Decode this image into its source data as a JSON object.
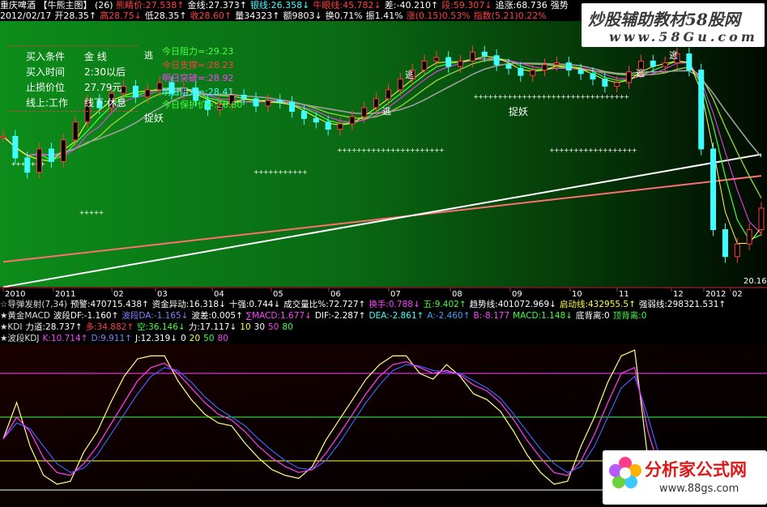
{
  "app": {
    "stock_name": "重庆啤酒",
    "tab_label": "【牛熊主图】",
    "tab_count": "(26)",
    "watermark_top": "炒股辅助教材58股网",
    "watermark_top_url": "www.58Gu.com",
    "watermark_bottom": "分析家公式网",
    "watermark_bottom_url": "www.88gs.com"
  },
  "header_row1": [
    {
      "text": "熊睛价:27.538↑",
      "color": "#ff4040"
    },
    {
      "text": "金线:27.373↑",
      "color": "#ffffff"
    },
    {
      "text": "银线:26.358↓",
      "color": "#40ffff"
    },
    {
      "text": "牛眼线:45.782↓",
      "color": "#ff4040"
    },
    {
      "text": "差:-40.210↑",
      "color": "#ffffff"
    },
    {
      "text": "段:59.307↓",
      "color": "#ff4040"
    },
    {
      "text": "追涨:68.736",
      "color": "#ffffff"
    },
    {
      "text": "强势",
      "color": "#ffffff"
    }
  ],
  "header_row2": [
    {
      "text": "2012/02/17",
      "color": "#ffffff"
    },
    {
      "text": "开28.35↑",
      "color": "#ffffff"
    },
    {
      "text": "高28.75↓",
      "color": "#ff4040"
    },
    {
      "text": "低28.35↑",
      "color": "#ffffff"
    },
    {
      "text": "收28.60↑",
      "color": "#ff4040"
    },
    {
      "text": "量34323↑",
      "color": "#ffffff"
    },
    {
      "text": "额9803↓",
      "color": "#ffffff"
    },
    {
      "text": "换0.71%",
      "color": "#ffffff"
    },
    {
      "text": "振1.41%",
      "color": "#ffffff"
    },
    {
      "text": "涨(0.15)0.53%",
      "color": "#ff4040"
    },
    {
      "text": "指数(5.21)0.22%",
      "color": "#ff4040"
    }
  ],
  "info_box": [
    {
      "label": "买入条件",
      "value": "金 线"
    },
    {
      "label": "买入时间",
      "value": "2:30以后"
    },
    {
      "label": "止损价位",
      "value": "27.79元"
    },
    {
      "label": "线上:工作",
      "value": "线下:休息"
    }
  ],
  "levels": [
    {
      "text": "今日阻力=:29.23",
      "color": "#40ff40"
    },
    {
      "text": "今日支撑=:28.23",
      "color": "#ff4040"
    },
    {
      "text": "明日突破=:28.92",
      "color": "#ff40ff"
    },
    {
      "text": "明日阻力=:28.41",
      "color": "#40ffff"
    },
    {
      "text": "今日保护价=:28.80",
      "color": "#40ff40"
    }
  ],
  "chart_labels": {
    "escape": "逃",
    "catch": "捉妖",
    "last_low": "20.16"
  },
  "x_axis": {
    "ticks": [
      "2010",
      "2011",
      "02",
      "03",
      "04",
      "05",
      "06",
      "07",
      "08",
      "09",
      "10",
      "11",
      "12",
      "2012",
      "02"
    ]
  },
  "indicator_rows": [
    [
      {
        "text": "☆导弹发射(7,34)",
        "color": "#dddddd"
      },
      {
        "text": "预警:470715.438↑",
        "color": "#ffffff"
      },
      {
        "text": "资金异动:16.318↓",
        "color": "#ffffff"
      },
      {
        "text": "十强:0.744↓",
        "color": "#ffffff"
      },
      {
        "text": "成交量比%:72.727↑",
        "color": "#ffffff"
      },
      {
        "text": "换手:0.788↓",
        "color": "#ff40ff"
      },
      {
        "text": "五:9.402↑",
        "color": "#40ff40"
      },
      {
        "text": "趋势线:401072.969↓",
        "color": "#ffffff"
      },
      {
        "text": "启动线:432955.5↑",
        "color": "#ffff40"
      },
      {
        "text": "强弱线:298321.531↑",
        "color": "#ffffff"
      }
    ],
    [
      {
        "text": "★黄金MACD",
        "color": "#dddddd"
      },
      {
        "text": "波段DF:-1.160↑",
        "color": "#ffffff"
      },
      {
        "text": "波段DA:-1.165↓",
        "color": "#8080ff"
      },
      {
        "text": "波差:0.005↑",
        "color": "#ffffff"
      },
      {
        "text": "∑MACD:1.677↓",
        "color": "#ff40ff"
      },
      {
        "text": "DIF:-2.287↑",
        "color": "#ffffff"
      },
      {
        "text": "DEA:-2.861↑",
        "color": "#40ffff"
      },
      {
        "text": "A:-2.460↑",
        "color": "#40a0ff"
      },
      {
        "text": "B:-8.177",
        "color": "#ff40ff"
      },
      {
        "text": "MACD:1.148↓",
        "color": "#40ff40"
      },
      {
        "text": "底背离:0",
        "color": "#ffffff"
      },
      {
        "text": "顶背离:0",
        "color": "#40ff40"
      }
    ],
    [
      {
        "text": "★KDI",
        "color": "#dddddd"
      },
      {
        "text": "力道:28.737↑",
        "color": "#ffffff"
      },
      {
        "text": "多:34.882↑",
        "color": "#ff4040"
      },
      {
        "text": "空:36.146↓",
        "color": "#40ff40"
      },
      {
        "text": "力:17.117↓",
        "color": "#ffffff"
      },
      {
        "text": "10",
        "color": "#ffff40"
      },
      {
        "text": "30",
        "color": "#ffffff"
      },
      {
        "text": "50",
        "color": "#ff40ff"
      },
      {
        "text": "80",
        "color": "#40ff40"
      }
    ],
    [
      {
        "text": "★波段KDJ",
        "color": "#dddddd"
      },
      {
        "text": "K:10.714↑",
        "color": "#ff40ff"
      },
      {
        "text": "D:9.911↑",
        "color": "#8080ff"
      },
      {
        "text": "J:12.319↓",
        "color": "#ffffff"
      },
      {
        "text": "0",
        "color": "#ffffff"
      },
      {
        "text": "20",
        "color": "#ffff40"
      },
      {
        "text": "50",
        "color": "#40ff40"
      },
      {
        "text": "80",
        "color": "#ff40ff"
      }
    ]
  ],
  "kdj": {
    "levels": [
      0,
      20,
      50,
      80
    ],
    "level_colors": [
      "#ffffff",
      "#ffff40",
      "#40ff40",
      "#ff40ff"
    ]
  },
  "chart_data": {
    "type": "line",
    "title": "",
    "price": {
      "description_free": true,
      "close": [
        26.2,
        25.0,
        24.2,
        25.5,
        24.8,
        26.0,
        27.0,
        28.2,
        27.8,
        28.6,
        29.0,
        28.4,
        28.8,
        29.2,
        28.6,
        28.9,
        28.2,
        27.7,
        28.0,
        28.5,
        28.3,
        27.9,
        28.2,
        28.1,
        27.6,
        27.2,
        27.0,
        26.6,
        26.9,
        27.3,
        27.8,
        28.3,
        28.8,
        29.4,
        29.9,
        30.4,
        30.6,
        30.1,
        30.4,
        30.9,
        30.7,
        30.2,
        30.0,
        29.6,
        29.9,
        30.2,
        30.3,
        29.9,
        29.7,
        29.4,
        29.0,
        29.2,
        29.8,
        30.4,
        30.1,
        30.3,
        30.8,
        29.9,
        25.5,
        21.0,
        19.5,
        20.2,
        21.0,
        22.2
      ]
    },
    "long_lines": [
      {
        "name": "",
        "color": "#ff7070",
        "values": [
          19.2,
          24.0
        ]
      },
      {
        "name": "",
        "color": "#ffffff",
        "values": [
          17.8,
          25.2
        ]
      }
    ],
    "kdj": {
      "K": [
        35,
        50,
        40,
        22,
        12,
        10,
        18,
        30,
        45,
        60,
        75,
        84,
        87,
        80,
        70,
        60,
        52,
        48,
        40,
        30,
        22,
        16,
        12,
        14,
        25,
        38,
        52,
        66,
        78,
        86,
        88,
        84,
        80,
        82,
        79,
        72,
        68,
        60,
        48,
        34,
        22,
        12,
        10,
        20,
        38,
        60,
        80,
        84,
        40,
        10,
        9,
        11
      ],
      "D": [
        35,
        46,
        42,
        30,
        18,
        12,
        15,
        24,
        38,
        52,
        66,
        78,
        84,
        82,
        74,
        64,
        56,
        50,
        44,
        35,
        27,
        20,
        15,
        14,
        20,
        32,
        46,
        60,
        72,
        82,
        86,
        85,
        82,
        81,
        80,
        75,
        70,
        63,
        52,
        40,
        28,
        18,
        12,
        16,
        30,
        50,
        70,
        78,
        50,
        18,
        10,
        10
      ],
      "J": [
        35,
        60,
        30,
        10,
        4,
        6,
        26,
        40,
        60,
        78,
        90,
        92,
        92,
        75,
        62,
        52,
        46,
        44,
        32,
        22,
        14,
        10,
        8,
        16,
        34,
        48,
        62,
        76,
        86,
        92,
        92,
        80,
        76,
        86,
        78,
        66,
        62,
        54,
        40,
        24,
        12,
        4,
        6,
        30,
        50,
        74,
        92,
        96,
        20,
        2,
        8,
        12
      ]
    }
  }
}
